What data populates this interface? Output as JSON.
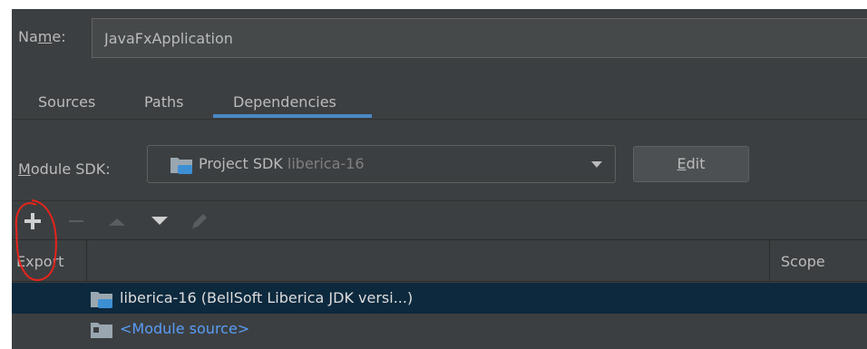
{
  "name": {
    "label_prefix": "Na",
    "label_mnemonic": "m",
    "label_suffix": "e:",
    "value": "JavaFxApplication"
  },
  "tabs": [
    {
      "label": "Sources",
      "active": false
    },
    {
      "label": "Paths",
      "active": false
    },
    {
      "label": "Dependencies",
      "active": true
    }
  ],
  "module_sdk": {
    "label_mnemonic": "M",
    "label_rest": "odule SDK:",
    "selected_main": "Project SDK",
    "selected_dim": "liberica-16",
    "edit_mnemonic": "E",
    "edit_rest": "dit"
  },
  "toolbar": {
    "icons": [
      "add-icon",
      "remove-icon",
      "move-up-icon",
      "move-down-icon",
      "edit-icon"
    ]
  },
  "table": {
    "columns": [
      "Export",
      "Scope"
    ],
    "rows": [
      {
        "text": "liberica-16 (BellSoft Liberica JDK versi...)",
        "icon": "sdk-folder-icon",
        "selected": true
      },
      {
        "text": "<Module source>",
        "icon": "module-source-folder-icon",
        "selected": false
      }
    ]
  },
  "colors": {
    "panel_bg": "#3c3f41",
    "accent": "#4a88c7",
    "selection": "#0d293e",
    "link": "#589df6",
    "annotation_red": "#e8231c"
  }
}
